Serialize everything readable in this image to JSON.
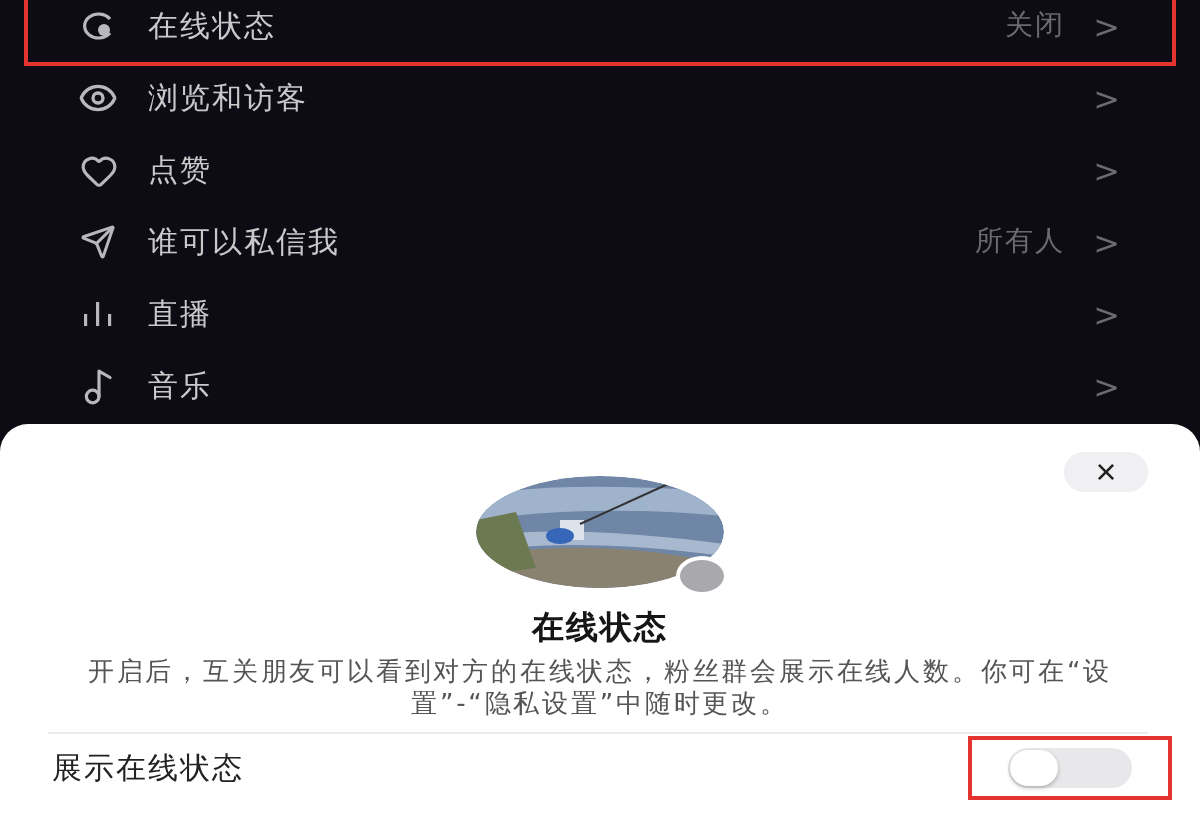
{
  "settings_list": [
    {
      "kind": "online",
      "label": "在线状态",
      "value": "关闭",
      "chevron": ">",
      "highlighted": true
    },
    {
      "kind": "eye",
      "label": "浏览和访客",
      "chevron": ">",
      "highlighted": false
    },
    {
      "kind": "heart",
      "label": "点赞",
      "chevron": ">",
      "highlighted": false
    },
    {
      "kind": "send",
      "label": "谁可以私信我",
      "value": "所有人",
      "chevron": ">",
      "highlighted": false
    },
    {
      "kind": "live",
      "label": "直播",
      "chevron": ">",
      "highlighted": false
    },
    {
      "kind": "music",
      "label": "音乐",
      "chevron": ">",
      "highlighted": false
    }
  ],
  "sheet": {
    "close": "×",
    "title": "在线状态",
    "description": "开启后，互关朋友可以看到对方的在线状态，粉丝群会展示在线人数。你可在“设置”-“隐私设置”中随时更改。",
    "toggle_row": {
      "label": "展示在线状态",
      "on": false,
      "highlighted": true
    }
  }
}
